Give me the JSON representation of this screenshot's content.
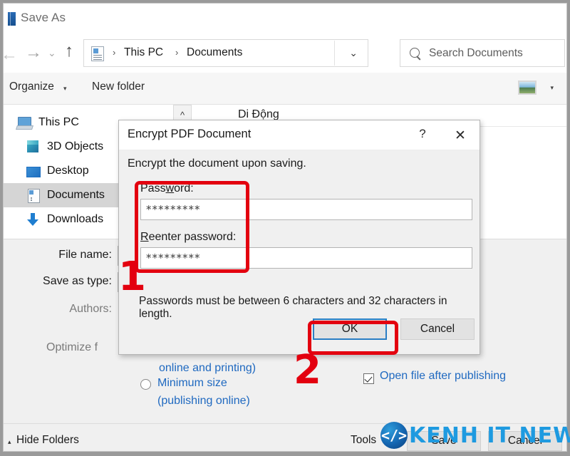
{
  "window": {
    "title": "Save As",
    "icon": "window-icon"
  },
  "nav": {
    "back_icon": "←",
    "forward_icon": "→",
    "recent_icon": "⌄",
    "up_icon": "↑",
    "refresh_icon": "↻",
    "chevron_icon": "⌄"
  },
  "address": {
    "icon": "documents-folder-icon",
    "crumbs": [
      "This PC",
      "Documents"
    ],
    "separator": "›"
  },
  "search": {
    "placeholder": "Search Documents",
    "icon": "search-icon"
  },
  "command_bar": {
    "organize": "Organize",
    "new_folder": "New folder",
    "caret": "▾",
    "view_icon": "view-layout-icon"
  },
  "sidebar": {
    "items": [
      {
        "label": "This PC",
        "icon": "this-pc-icon",
        "selected": false
      },
      {
        "label": "3D Objects",
        "icon": "cube-icon",
        "selected": false
      },
      {
        "label": "Desktop",
        "icon": "desktop-icon",
        "selected": false
      },
      {
        "label": "Documents",
        "icon": "document-icon",
        "selected": true
      },
      {
        "label": "Downloads",
        "icon": "download-icon",
        "selected": false
      }
    ]
  },
  "file_list": {
    "collapse_icon": "^",
    "group_title": "Di Động"
  },
  "form": {
    "file_name_label": "File name:",
    "file_name_value": "",
    "save_as_type_label": "Save as type:",
    "save_as_type_value": ".",
    "authors_label": "Authors:",
    "optimize_label": "Optimize f",
    "optimize_options": [
      "online and printing)",
      "Minimum size",
      "(publishing online)"
    ],
    "open_after_publishing": "Open file after publishing",
    "open_after_publishing_checked": true
  },
  "footer": {
    "hide_folders": "Hide Folders",
    "hide_caret": "▴",
    "tools": "Tools",
    "tools_caret": "▾",
    "save": "Save",
    "cancel": "Cancel"
  },
  "dialog": {
    "title": "Encrypt PDF Document",
    "help_icon": "?",
    "close_icon": "✕",
    "subtitle": "Encrypt the document upon saving.",
    "password_label_pre": "Pass",
    "password_label_accel": "w",
    "password_label_post": "ord:",
    "password_value": "*********",
    "reenter_label_accel": "R",
    "reenter_label_post": "eenter password:",
    "reenter_value": "*********",
    "hint": "Passwords must be between 6 characters and 32 characters in length.",
    "ok": "OK",
    "cancel": "Cancel"
  },
  "annotations": {
    "marker_1": "1",
    "marker_2": "2",
    "color": "#e3000f"
  },
  "watermark": {
    "glyph": "</>",
    "text": "KENH IT NEWS",
    "color": "#1e9ae0"
  }
}
